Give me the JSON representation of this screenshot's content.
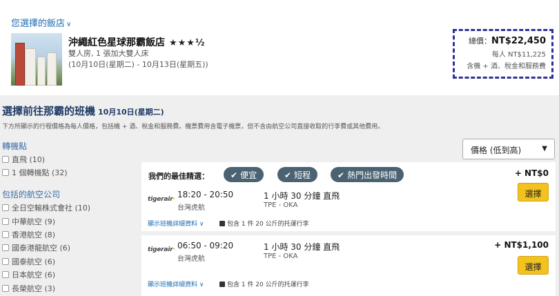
{
  "hotel": {
    "heading": "您選擇的飯店",
    "heading_icon": "chevron-down-icon",
    "name": "沖繩紅色星球那霸飯店",
    "stars": "★★★",
    "half_star": "½",
    "star_rating": 3.5,
    "room": "雙人房, 1 張加大雙人床",
    "dates": "(10月10日(星期二) - 10月13日(星期五))",
    "price_total_label": "總價：",
    "price_total": "NT$22,450",
    "price_per_person": "每人 NT$11,225",
    "price_note": "含機 + 酒、稅金和服務費"
  },
  "flights": {
    "title": "選擇前往那霸的班機",
    "date": "10月10日(星期二)",
    "subtitle": "下方所顯示的行程價格為每人價格，包括機 + 酒、稅金和服務費。機票費用含電子機票，但不含由航空公司直接收取的行李費或其他費用。"
  },
  "sort": {
    "selected": "價格 (低到高)"
  },
  "filters": {
    "stops_heading": "轉機點",
    "stops": [
      {
        "label": "直飛 (10)"
      },
      {
        "label": "1 個轉機點 (32)"
      }
    ],
    "airlines_heading": "包括的航空公司",
    "airlines": [
      {
        "label": "全日空輸株式會社 (10)"
      },
      {
        "label": "中華航空 (9)"
      },
      {
        "label": "香港航空 (8)"
      },
      {
        "label": "國泰港龍航空 (6)"
      },
      {
        "label": "國泰航空 (6)"
      },
      {
        "label": "日本航空 (6)"
      },
      {
        "label": "長榮航空 (3)"
      }
    ]
  },
  "results": [
    {
      "best_label": "我們的最佳精選：",
      "tags": [
        "便宜",
        "短程",
        "熱門出發時間"
      ],
      "price": "+ NT$0",
      "select_label": "選擇",
      "logo_text": "tigerair",
      "times": "18:20 - 20:50",
      "airline": "台灣虎航",
      "duration": "1 小時 30 分鐘 直飛",
      "route": "TPE - OKA",
      "details_link": "顯示班機詳細資料",
      "baggage": "包含 1 件 20 公斤的托運行李"
    },
    {
      "price": "+ NT$1,100",
      "select_label": "選擇",
      "logo_text": "tigerair",
      "times": "06:50 - 09:20",
      "airline": "台灣虎航",
      "duration": "1 小時 30 分鐘 直飛",
      "route": "TPE - OKA",
      "details_link": "顯示班機詳細資料",
      "baggage": "包含 1 件 20 公斤的托運行李"
    }
  ]
}
